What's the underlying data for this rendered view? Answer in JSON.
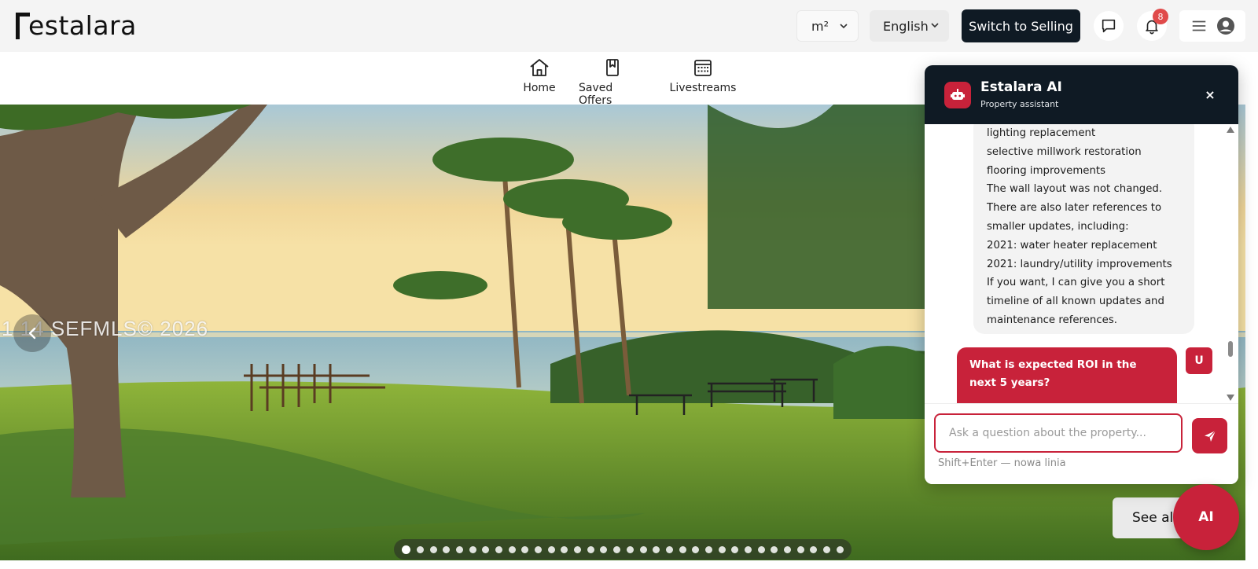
{
  "brand": {
    "name": "estalara"
  },
  "header": {
    "unit_select": "m²",
    "language_select": "English",
    "switch_button": "Switch to Selling",
    "notifications_count": "8"
  },
  "nav": {
    "items": [
      {
        "label": "Home",
        "icon": "home-icon"
      },
      {
        "label": "Saved Offers",
        "icon": "bookmark-icon"
      },
      {
        "label": "Livestreams",
        "icon": "calendar-icon"
      }
    ]
  },
  "hero": {
    "watermark": "1  14  SEFMLS© 2026",
    "see_all": "See all",
    "slide_count": 34,
    "active_slide": 0
  },
  "chat": {
    "title": "Estalara AI",
    "subtitle": "Property assistant",
    "close": "×",
    "bot_message": [
      "lighting replacement",
      "selective millwork restoration",
      "flooring improvements",
      "The wall layout was not changed.",
      "There are also later references to",
      "smaller updates, including:",
      "2021: water heater replacement",
      "2021: laundry/utility improvements",
      "If you want, I can give you a short",
      "timeline of all known updates and",
      "maintenance references."
    ],
    "user_message": "What is expected ROI in the next 5 years?",
    "user_avatar": "U",
    "input_placeholder": "Ask a question about the property...",
    "input_value": "",
    "hint": "Shift+Enter — nowa linia"
  },
  "ai_fab": "AI",
  "colors": {
    "accent": "#c8223a",
    "dark": "#0f1a24",
    "badge": "#e04a4a"
  }
}
